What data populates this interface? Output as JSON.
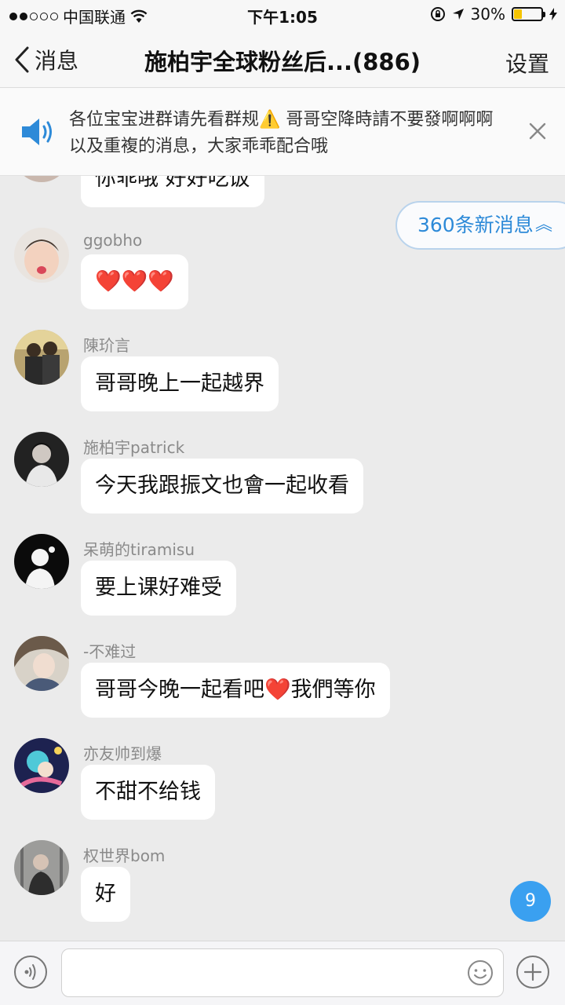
{
  "status_bar": {
    "carrier": "中国联通",
    "time": "下午1:05",
    "battery_percent": "30%",
    "battery_level": 0.3,
    "signal_bars_filled": 2,
    "signal_bars_total": 5
  },
  "nav": {
    "back_label": "消息",
    "title": "施柏宇全球粉丝后...(886)",
    "settings_label": "设置"
  },
  "notice": {
    "text": "各位宝宝进群请先看群规⚠️ 哥哥空降時請不要發啊啊啊以及重複的消息，大家乖乖配合哦"
  },
  "new_messages": {
    "label": "360条新消息",
    "chevron": "︽"
  },
  "messages": [
    {
      "sender": "",
      "text": "你乖哦 好好吃饭"
    },
    {
      "sender": "ggobho",
      "text": "❤️❤️❤️"
    },
    {
      "sender": "陳玠言",
      "text": "哥哥晚上一起越界"
    },
    {
      "sender": "施柏宇patrick",
      "text": "今天我跟振文也會一起收看"
    },
    {
      "sender": "呆萌的tiramisu",
      "text": "要上课好难受"
    },
    {
      "sender": "-不难过",
      "text": "哥哥今晚一起看吧❤️我們等你"
    },
    {
      "sender": "亦友帅到爆",
      "text": "不甜不给钱"
    },
    {
      "sender": "权世界bom",
      "text": "好"
    }
  ],
  "unread_badge": "9",
  "colors": {
    "accent_blue": "#2d8ad8",
    "badge_blue": "#3aa0f0",
    "chat_bg": "#ebebeb",
    "battery_yellow": "#f5c400"
  },
  "icons": {
    "back": "chevron-left-icon",
    "speaker": "speaker-icon",
    "close": "close-icon",
    "voice": "voice-icon",
    "emoji": "emoji-icon",
    "plus": "plus-icon",
    "wifi": "wifi-icon",
    "location": "location-arrow-icon",
    "lock": "rotation-lock-icon"
  }
}
